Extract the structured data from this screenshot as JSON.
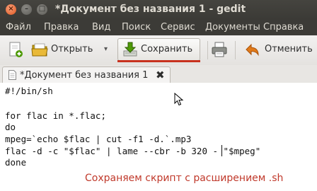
{
  "window": {
    "title": "*Документ без названия 1 - gedit",
    "close_glyph": "×",
    "min_glyph": "–",
    "max_glyph": "□"
  },
  "menu": {
    "items": [
      "Файл",
      "Правка",
      "Вид",
      "Поиск",
      "Сервис",
      "Документы",
      "Справка"
    ]
  },
  "toolbar": {
    "open_label": "Открыть",
    "save_label": "Сохранить",
    "undo_label": "Отменить",
    "dropdown_glyph": "▾"
  },
  "tab": {
    "label": "*Документ без названия 1",
    "close_glyph": "✖"
  },
  "editor": {
    "lines": [
      "#!/bin/sh",
      "",
      "for flac in *.flac;",
      "do",
      "mpeg=`echo $flac | cut -f1 -d.`.mp3",
      "flac -d -c \"$flac\" | lame --cbr -b 320 - \"$mpeg\"",
      "done"
    ]
  },
  "annotation": {
    "text": "Сохраняем скрипт с расширением .sh"
  },
  "colors": {
    "titlebar": "#3c3b37",
    "highlight_underline": "#c8321f",
    "annotation": "#c0392b"
  }
}
